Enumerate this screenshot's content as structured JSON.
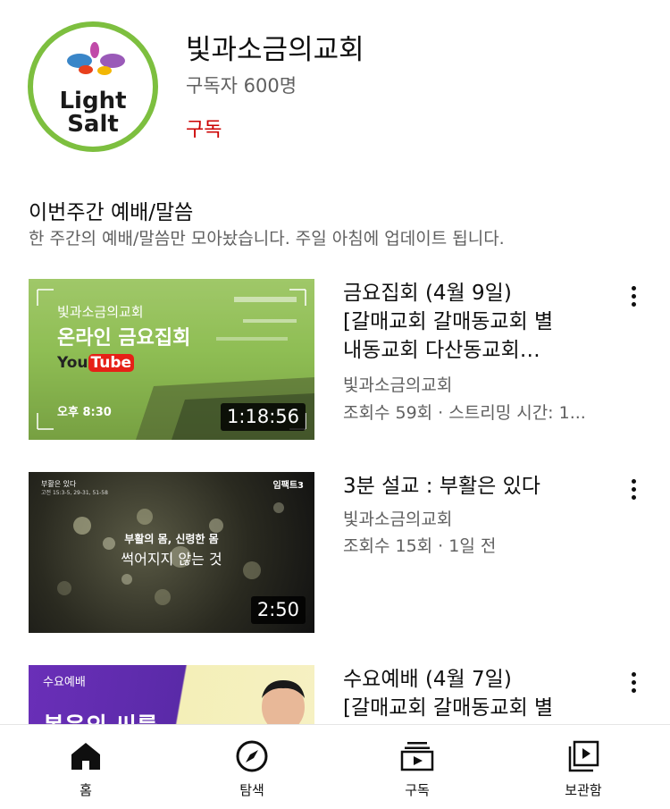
{
  "channel": {
    "name": "빛과소금의교회",
    "subscribers": "구독자 600명",
    "subscribe_label": "구독",
    "logo_line1": "Light",
    "logo_line2": "Salt"
  },
  "section": {
    "title": "이번주간 예배/말씀",
    "description": "한 주간의 예배/말씀만 모아놨습니다. 주일 아침에 업데이트 됩니다."
  },
  "videos": [
    {
      "title_lines": [
        "금요집회 (4월 9일)",
        "[갈매교회 갈매동교회 별",
        "내동교회 다산동교회…"
      ],
      "channel": "빛과소금의교회",
      "meta": "조회수 59회 · 스트리밍 시간: 1...",
      "duration": "1:18:56",
      "thumb": {
        "church": "빛과소금의교회",
        "headline": "온라인 금요집회",
        "platform_you": "You",
        "platform_tube": "Tube",
        "time": "오후 8:30"
      }
    },
    {
      "title_lines": [
        "3분 설교 : 부활은 있다"
      ],
      "channel": "빛과소금의교회",
      "meta": "조회수 15회 · 1일 전",
      "duration": "2:50",
      "thumb": {
        "topleft1": "부활은 있다",
        "topleft2": "고전 15:3-5, 29-31, 51-58",
        "topright": "임팩트3",
        "line1": "부활의 몸, 신령한 몸",
        "line2": "썩어지지 않는 것"
      }
    },
    {
      "title_lines": [
        "수요예배 (4월 7일)",
        "[갈매교회 갈매동교회 별"
      ],
      "thumb": {
        "tag": "수요예배",
        "headline": "복음의 씨를"
      }
    }
  ],
  "nav": [
    {
      "label": "홈",
      "icon": "home-icon"
    },
    {
      "label": "탐색",
      "icon": "explore-icon"
    },
    {
      "label": "구독",
      "icon": "subscriptions-icon"
    },
    {
      "label": "보관함",
      "icon": "library-icon"
    }
  ],
  "colors": {
    "accent_red": "#cc0000",
    "logo_ring": "#7dbf3f",
    "text_secondary": "#606060"
  }
}
